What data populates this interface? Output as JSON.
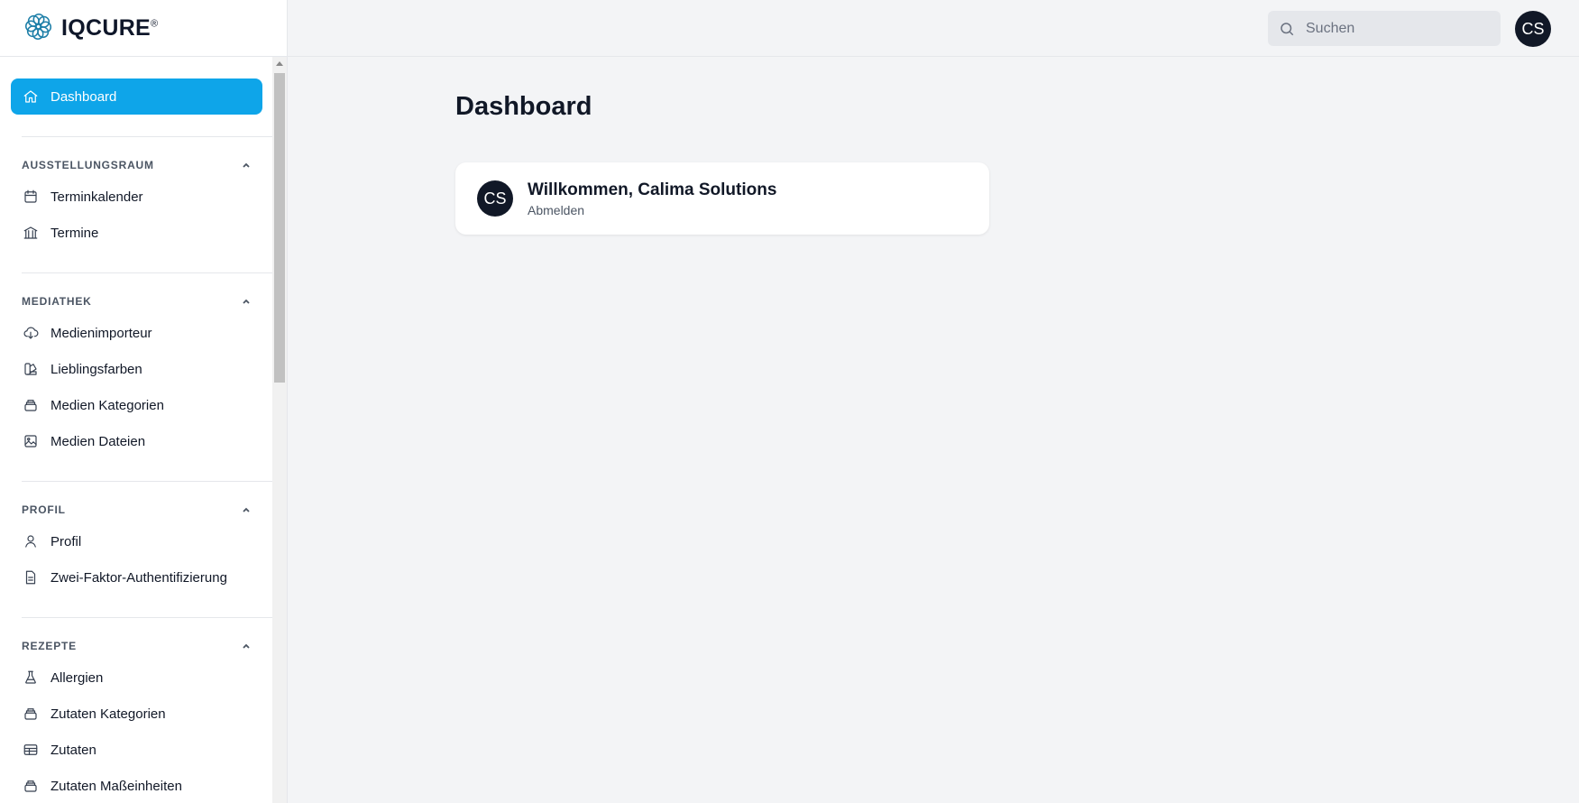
{
  "brand": {
    "name": "IQCURE",
    "mark": "®"
  },
  "sidebar": {
    "dashboard_label": "Dashboard",
    "groups": [
      {
        "title": "AUSSTELLUNGSRAUM",
        "items": [
          {
            "label": "Terminkalender",
            "icon": "calendar-icon"
          },
          {
            "label": "Termine",
            "icon": "building-icon"
          }
        ]
      },
      {
        "title": "MEDIATHEK",
        "items": [
          {
            "label": "Medienimporteur",
            "icon": "cloud-download-icon"
          },
          {
            "label": "Lieblingsfarben",
            "icon": "swatch-icon"
          },
          {
            "label": "Medien Kategorien",
            "icon": "stack-icon"
          },
          {
            "label": "Medien Dateien",
            "icon": "image-icon"
          }
        ]
      },
      {
        "title": "PROFIL",
        "items": [
          {
            "label": "Profil",
            "icon": "user-icon"
          },
          {
            "label": "Zwei-Faktor-Authentifizierung",
            "icon": "document-icon"
          }
        ]
      },
      {
        "title": "REZEPTE",
        "items": [
          {
            "label": "Allergien",
            "icon": "beaker-icon"
          },
          {
            "label": "Zutaten Kategorien",
            "icon": "stack-icon"
          },
          {
            "label": "Zutaten",
            "icon": "table-icon"
          },
          {
            "label": "Zutaten Maßeinheiten",
            "icon": "stack-icon"
          }
        ]
      }
    ]
  },
  "topbar": {
    "search_placeholder": "Suchen",
    "avatar_initials": "CS"
  },
  "main": {
    "title": "Dashboard",
    "welcome": {
      "initials": "CS",
      "title": "Willkommen, Calima Solutions",
      "logout_label": "Abmelden"
    }
  },
  "colors": {
    "accent": "#0ea5e9",
    "avatar_bg": "#111827",
    "background": "#f3f4f6"
  }
}
